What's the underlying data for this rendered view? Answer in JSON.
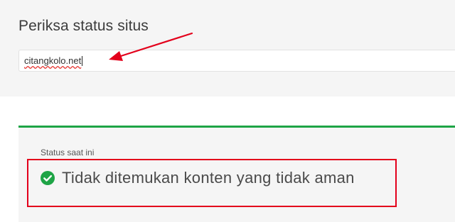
{
  "search": {
    "title": "Periksa status situs",
    "value": "citangkolo.net"
  },
  "status": {
    "label": "Status saat ini",
    "text": "Tidak ditemukan konten yang tidak aman"
  },
  "colors": {
    "accent_green": "#1ea446",
    "annotation_red": "#e3001b"
  },
  "icons": {
    "status": "check-circle-icon"
  }
}
